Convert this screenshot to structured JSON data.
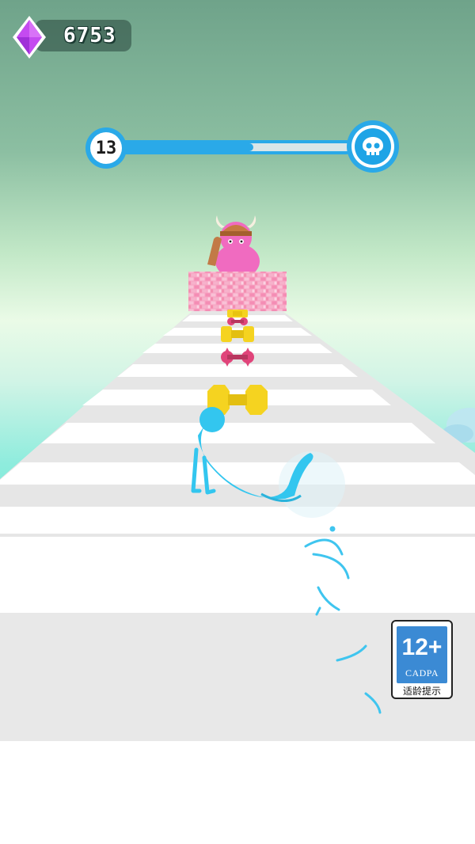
{
  "hud": {
    "gem_count": "6753",
    "gem_icon": "gem-icon",
    "gem_color": "#c44bf0"
  },
  "level": {
    "current": "13",
    "progress": 0.58,
    "boss_icon": "skull-icon",
    "accent": "#2aa9e8"
  },
  "age_rating": {
    "rating": "12+",
    "org": "CADPA",
    "caption": "适龄提示"
  },
  "scene": {
    "player_color": "#33c6ef",
    "boss_color": "#f06bc0",
    "dumbbell_color": "#f5d320",
    "spiked_color": "#e0447a"
  }
}
